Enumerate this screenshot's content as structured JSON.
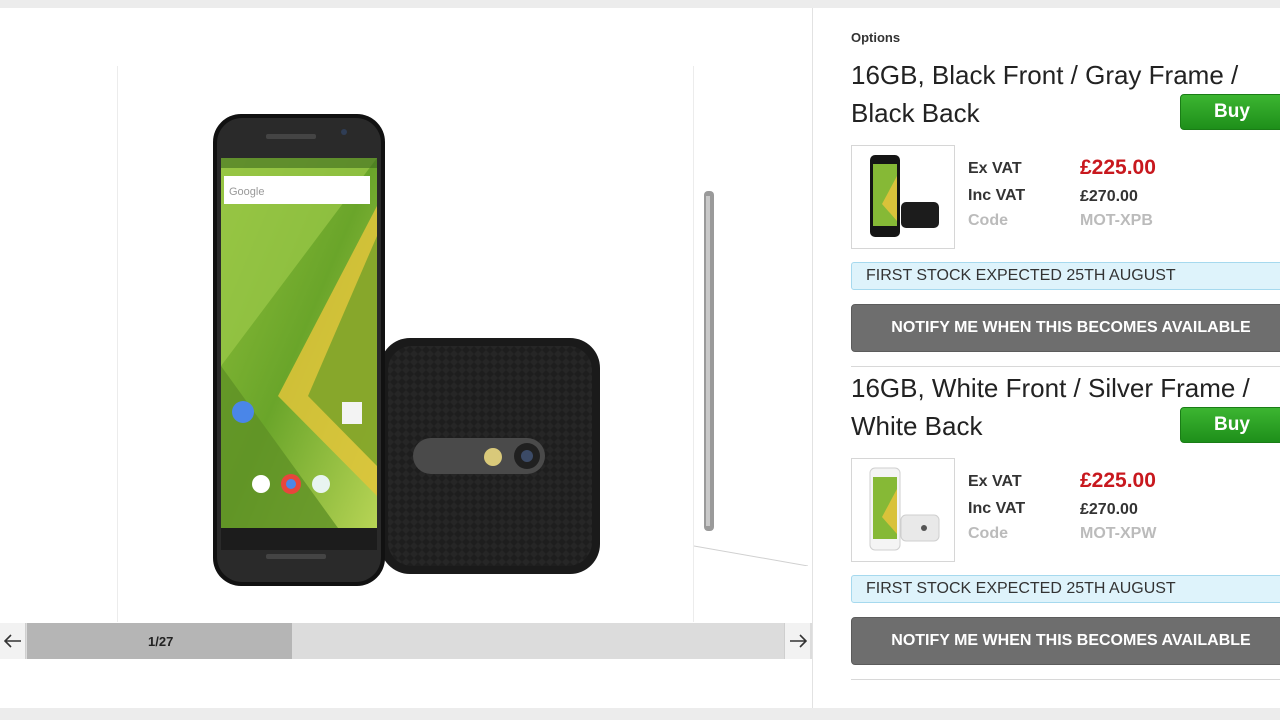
{
  "gallery": {
    "counter": "1/27",
    "progress_fraction": 0.35,
    "prev_icon": "arrow-left-icon",
    "next_icon": "arrow-right-icon"
  },
  "options": {
    "label": "Options",
    "products": [
      {
        "title": "16GB, Black Front / Gray Frame / Black Back",
        "buy_label": "Buy",
        "ex_vat_label": "Ex VAT",
        "ex_vat_price": "£225.00",
        "inc_vat_label": "Inc VAT",
        "inc_vat_price": "£270.00",
        "code_label": "Code",
        "code": "MOT-XPB",
        "stock_text": "FIRST STOCK EXPECTED 25TH AUGUST",
        "notify_label": "NOTIFY ME WHEN THIS BECOMES AVAILABLE"
      },
      {
        "title": "16GB, White Front / Silver Frame / White Back",
        "buy_label": "Buy",
        "ex_vat_label": "Ex VAT",
        "ex_vat_price": "£225.00",
        "inc_vat_label": "Inc VAT",
        "inc_vat_price": "£270.00",
        "code_label": "Code",
        "code": "MOT-XPW",
        "stock_text": "FIRST STOCK EXPECTED 25TH AUGUST",
        "notify_label": "NOTIFY ME WHEN THIS BECOMES AVAILABLE"
      }
    ]
  },
  "colors": {
    "buy_green": "#2aa326",
    "price_red": "#c8181e",
    "notify_gray": "#6e6e6e",
    "stock_blue_bg": "#def3fb"
  }
}
